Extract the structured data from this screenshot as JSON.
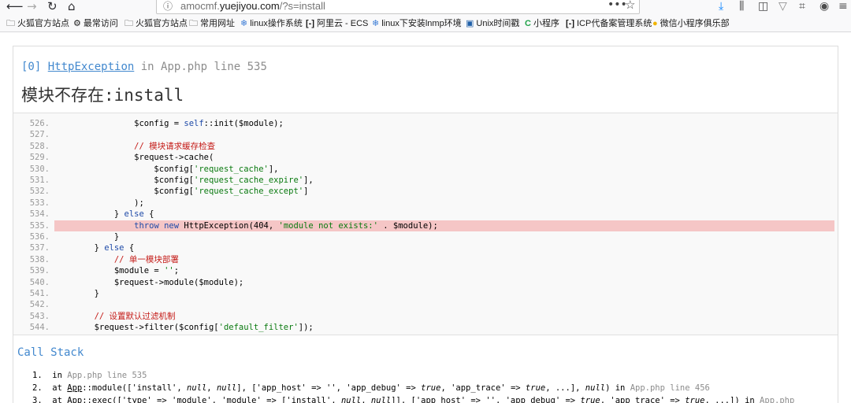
{
  "browser": {
    "url_prefix": "amocmf.",
    "url_host": "yuejiyou.com",
    "url_path": "/?s=install"
  },
  "bookmarks": [
    {
      "icon": "folder-icon",
      "glyph": "🗀",
      "label": "火狐官方站点"
    },
    {
      "icon": "gear-icon",
      "glyph": "⚙",
      "label": "最常访问"
    },
    {
      "icon": "folder-icon",
      "glyph": "🗀",
      "label": "火狐官方站点"
    },
    {
      "icon": "folder-icon",
      "glyph": "🗀",
      "label": "常用网址"
    },
    {
      "icon": "snowflake-icon",
      "glyph": "❄",
      "label": "linux操作系统"
    },
    {
      "icon": "aliyun-icon",
      "glyph": "[-]",
      "label": "阿里云 - ECS"
    },
    {
      "icon": "snowflake-icon",
      "glyph": "❄",
      "label": "linux下安装lnmp环境"
    },
    {
      "icon": "unix-icon",
      "glyph": "▣",
      "label": "Unix时间戳"
    },
    {
      "icon": "c-logo-icon",
      "glyph": "C",
      "label": "小程序"
    },
    {
      "icon": "aliyun-icon",
      "glyph": "[-]",
      "label": "ICP代备案管理系统"
    },
    {
      "icon": "wechat-icon",
      "glyph": "●",
      "label": "微信小程序俱乐部"
    }
  ],
  "exception": {
    "index": "[0]",
    "class": "HttpException",
    "in": "in",
    "file_line": "App.php line 535",
    "message": "模块不存在:install"
  },
  "source": {
    "highlight_line": "535.",
    "lines": [
      {
        "n": "526.",
        "code": "                $config = self::init($module);"
      },
      {
        "n": "527.",
        "code": ""
      },
      {
        "n": "528.",
        "code": "                // 模块请求缓存检查"
      },
      {
        "n": "529.",
        "code": "                $request->cache("
      },
      {
        "n": "530.",
        "code": "                    $config['request_cache'],"
      },
      {
        "n": "531.",
        "code": "                    $config['request_cache_expire'],"
      },
      {
        "n": "532.",
        "code": "                    $config['request_cache_except']"
      },
      {
        "n": "533.",
        "code": "                );"
      },
      {
        "n": "534.",
        "code": "            } else {"
      },
      {
        "n": "535.",
        "code": "                throw new HttpException(404, 'module not exists:' . $module);"
      },
      {
        "n": "536.",
        "code": "            }"
      },
      {
        "n": "537.",
        "code": "        } else {"
      },
      {
        "n": "538.",
        "code": "            // 单一模块部署"
      },
      {
        "n": "539.",
        "code": "            $module = '';"
      },
      {
        "n": "540.",
        "code": "            $request->module($module);"
      },
      {
        "n": "541.",
        "code": "        }"
      },
      {
        "n": "542.",
        "code": ""
      },
      {
        "n": "543.",
        "code": "        // 设置默认过滤机制"
      },
      {
        "n": "544.",
        "code": "        $request->filter($config['default_filter']);"
      }
    ]
  },
  "callstack": {
    "title": "Call Stack",
    "items": [
      {
        "n": "1.",
        "text": "in App.php line 535"
      },
      {
        "n": "2.",
        "text": "at App::module(['install', null, null], ['app_host' => '', 'app_debug' => true, 'app_trace' => true, ...], null) in App.php line 456"
      },
      {
        "n": "3.",
        "text": "at App::exec(['type' => 'module', 'module' => ['install', null, null]], ['app_host' => '', 'app_debug' => true, 'app_trace' => true, ...]) in App.php"
      }
    ]
  }
}
